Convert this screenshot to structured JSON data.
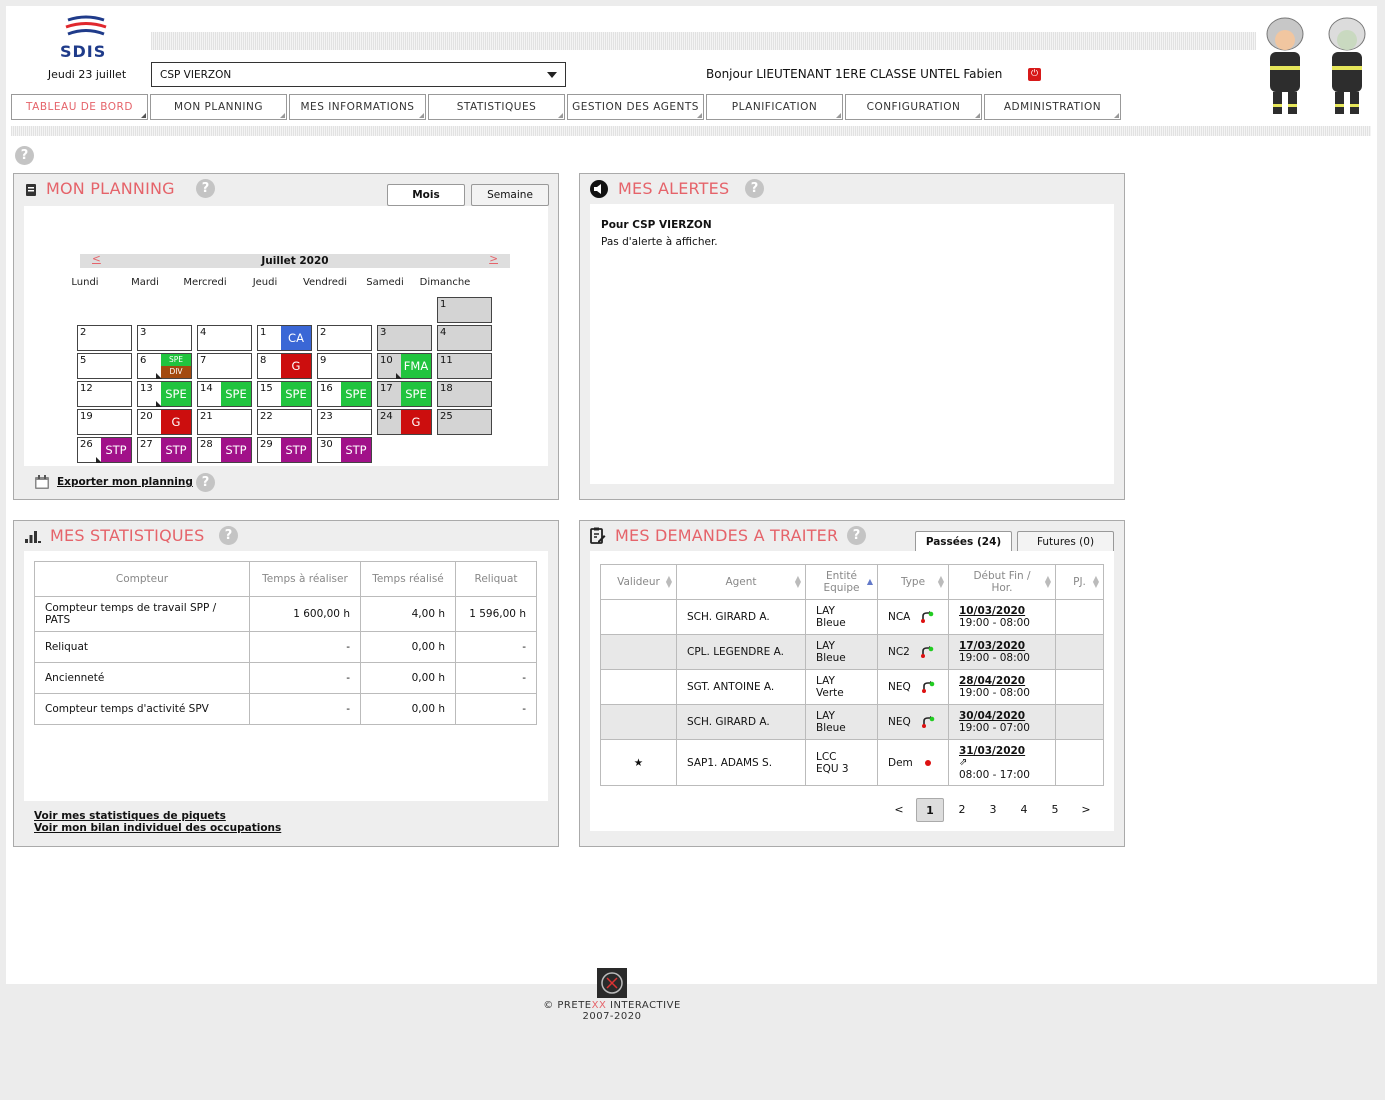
{
  "header": {
    "logo_text": "SDIS",
    "date": "Jeudi 23 juillet",
    "center_select": "CSP VIERZON",
    "greeting": "Bonjour LIEUTENANT 1ERE CLASSE UNTEL Fabien"
  },
  "nav": [
    {
      "label": "TABLEAU DE BORD",
      "active": true
    },
    {
      "label": "MON PLANNING"
    },
    {
      "label": "MES INFORMATIONS"
    },
    {
      "label": "STATISTIQUES"
    },
    {
      "label": "GESTION DES AGENTS"
    },
    {
      "label": "PLANIFICATION"
    },
    {
      "label": "CONFIGURATION"
    },
    {
      "label": "ADMINISTRATION"
    }
  ],
  "planning": {
    "title": "MON PLANNING",
    "view_month": "Mois",
    "view_week": "Semaine",
    "prev": "<",
    "next": ">",
    "month_label": "Juillet 2020",
    "days": [
      "Lundi",
      "Mardi",
      "Mercredi",
      "Jeudi",
      "Vendredi",
      "Samedi",
      "Dimanche"
    ],
    "export_label": "Exporter mon planning",
    "cells": [
      {
        "d": "1",
        "col": 6,
        "row": 0,
        "we": true
      },
      {
        "d": "2",
        "col": 0,
        "row": 1
      },
      {
        "d": "3",
        "col": 1,
        "row": 1
      },
      {
        "d": "4",
        "col": 2,
        "row": 1
      },
      {
        "d": "1",
        "col": 3,
        "row": 1,
        "badge": "CA",
        "cls": "b-ca"
      },
      {
        "d": "2",
        "col": 4,
        "row": 1
      },
      {
        "d": "3",
        "col": 5,
        "row": 1,
        "we": true
      },
      {
        "d": "4",
        "col": 6,
        "row": 1,
        "we": true
      },
      {
        "d": "5",
        "col": 0,
        "row": 2
      },
      {
        "d": "6",
        "col": 1,
        "row": 2,
        "split": [
          "SPE",
          "DIV"
        ]
      },
      {
        "d": "7",
        "col": 2,
        "row": 2
      },
      {
        "d": "8",
        "col": 3,
        "row": 2,
        "badge": "G",
        "cls": "b-g"
      },
      {
        "d": "9",
        "col": 4,
        "row": 2
      },
      {
        "d": "10",
        "col": 5,
        "row": 2,
        "we": true,
        "badge": "FMA",
        "cls": "b-fma",
        "tri": true
      },
      {
        "d": "11",
        "col": 6,
        "row": 2,
        "we": true
      },
      {
        "d": "12",
        "col": 0,
        "row": 3
      },
      {
        "d": "13",
        "col": 1,
        "row": 3,
        "badge": "SPE",
        "cls": "b-spe",
        "tri": true
      },
      {
        "d": "14",
        "col": 2,
        "row": 3,
        "badge": "SPE",
        "cls": "b-spe"
      },
      {
        "d": "15",
        "col": 3,
        "row": 3,
        "badge": "SPE",
        "cls": "b-spe"
      },
      {
        "d": "16",
        "col": 4,
        "row": 3,
        "badge": "SPE",
        "cls": "b-spe"
      },
      {
        "d": "17",
        "col": 5,
        "row": 3,
        "we": true,
        "badge": "SPE",
        "cls": "b-spe"
      },
      {
        "d": "18",
        "col": 6,
        "row": 3,
        "we": true
      },
      {
        "d": "19",
        "col": 0,
        "row": 4
      },
      {
        "d": "20",
        "col": 1,
        "row": 4,
        "badge": "G",
        "cls": "b-g"
      },
      {
        "d": "21",
        "col": 2,
        "row": 4
      },
      {
        "d": "22",
        "col": 3,
        "row": 4
      },
      {
        "d": "23",
        "col": 4,
        "row": 4
      },
      {
        "d": "24",
        "col": 5,
        "row": 4,
        "we": true,
        "badge": "G",
        "cls": "b-g"
      },
      {
        "d": "25",
        "col": 6,
        "row": 4,
        "we": true
      },
      {
        "d": "26",
        "col": 0,
        "row": 5,
        "badge": "STP",
        "cls": "b-stp",
        "tri": true
      },
      {
        "d": "27",
        "col": 1,
        "row": 5,
        "badge": "STP",
        "cls": "b-stp"
      },
      {
        "d": "28",
        "col": 2,
        "row": 5,
        "badge": "STP",
        "cls": "b-stp"
      },
      {
        "d": "29",
        "col": 3,
        "row": 5,
        "badge": "STP",
        "cls": "b-stp"
      },
      {
        "d": "30",
        "col": 4,
        "row": 5,
        "badge": "STP",
        "cls": "b-stp"
      }
    ]
  },
  "alerts": {
    "title": "MES ALERTES",
    "for_label": "Pour CSP VIERZON",
    "empty_text": "Pas d'alerte à afficher."
  },
  "stats": {
    "title": "MES STATISTIQUES",
    "headers": [
      "Compteur",
      "Temps à réaliser",
      "Temps réalisé",
      "Reliquat"
    ],
    "rows": [
      [
        "Compteur temps de travail SPP / PATS",
        "1 600,00 h",
        "4,00 h",
        "1 596,00 h"
      ],
      [
        "Reliquat",
        "-",
        "0,00 h",
        "-"
      ],
      [
        "Ancienneté",
        "-",
        "0,00 h",
        "-"
      ],
      [
        "Compteur temps d'activité SPV",
        "-",
        "0,00 h",
        "-"
      ]
    ],
    "link1": "Voir mes statistiques de piquets",
    "link2": "Voir mon bilan individuel des occupations"
  },
  "requests": {
    "title": "MES DEMANDES A TRAITER",
    "tab_past": "Passées (24)",
    "tab_future": "Futures (0)",
    "headers": [
      "Valideur",
      "Agent",
      "Entité Equipe",
      "Type",
      "Début Fin / Hor.",
      "PJ."
    ],
    "rows": [
      {
        "valideur": "",
        "agent": "SCH. GIRARD A.",
        "entite": "LAY",
        "equipe": "Bleue",
        "type": "NCA",
        "date": "10/03/2020",
        "hours": "19:00 - 08:00"
      },
      {
        "valideur": "",
        "agent": "CPL. LEGENDRE A.",
        "entite": "LAY",
        "equipe": "Bleue",
        "type": "NC2",
        "date": "17/03/2020",
        "hours": "19:00 - 08:00"
      },
      {
        "valideur": "",
        "agent": "SGT. ANTOINE A.",
        "entite": "LAY",
        "equipe": "Verte",
        "type": "NEQ",
        "date": "28/04/2020",
        "hours": "19:00 - 08:00"
      },
      {
        "valideur": "",
        "agent": "SCH. GIRARD A.",
        "entite": "LAY",
        "equipe": "Bleue",
        "type": "NEQ",
        "date": "30/04/2020",
        "hours": "19:00 - 07:00"
      },
      {
        "valideur": "★",
        "agent": "SAP1. ADAMS S.",
        "entite": "LCC",
        "equipe": "EQU 3",
        "type": "Dem",
        "date": "31/03/2020",
        "hours": "08:00 - 17:00"
      }
    ],
    "pagination": [
      "<",
      "1",
      "2",
      "3",
      "4",
      "5",
      ">"
    ]
  },
  "footer": {
    "company_prefix": "© PRETE",
    "company_mid": "XX",
    "company_suffix": " INTERACTIVE",
    "years": "2007-2020"
  },
  "colors": {
    "accent": "#e5636a",
    "ca": "#3a67d6",
    "g": "#cc0e0e",
    "spe": "#21c43e",
    "stp": "#a11189",
    "div": "#a34a0f"
  }
}
